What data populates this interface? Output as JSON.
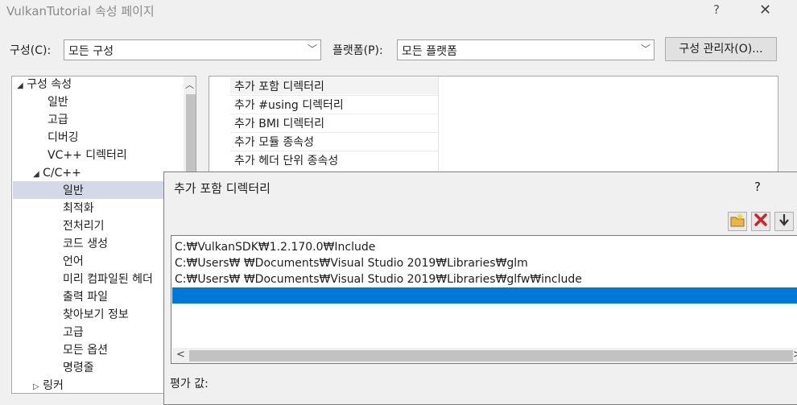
{
  "window": {
    "title": "VulkanTutorial 속성 페이지",
    "help": "?",
    "close": "✕"
  },
  "config": {
    "config_label": "구성(C):",
    "config_value": "모든 구성",
    "platform_label": "플랫폼(P):",
    "platform_value": "모든 플랫폼",
    "manager_button": "구성 관리자(O)..."
  },
  "tree": {
    "root": "구성 속성",
    "items": [
      "일반",
      "고급",
      "디버깅",
      "VC++ 디렉터리"
    ],
    "cc": "C/C++",
    "cc_items": [
      "일반",
      "최적화",
      "전처리기",
      "코드 생성",
      "언어",
      "미리 컴파일된 헤더",
      "출력 파일",
      "찾아보기 정보",
      "고급",
      "모든 옵션",
      "명령줄"
    ],
    "linker": "링커"
  },
  "grid": {
    "rows": [
      "추가 포함 디렉터리",
      "추가 #using 디렉터리",
      "추가 BMI 디렉터리",
      "추가 모듈 종속성",
      "추가 헤더 단위 종속성"
    ]
  },
  "dialog": {
    "title": "추가 포함 디렉터리",
    "help": "?",
    "toolbar": {
      "new_folder": "new-folder-icon",
      "delete": "delete-icon",
      "move_down": "arrow-down-icon"
    },
    "paths": [
      "C:₩VulkanSDK₩1.2.170.0₩Include",
      "C:₩Users₩          ₩Documents₩Visual Studio 2019₩Libraries₩glm",
      "C:₩Users₩          ₩Documents₩Visual Studio 2019₩Libraries₩glfw₩include"
    ],
    "evaluated_label": "평가 값:"
  },
  "colors": {
    "selection": "#0078d7",
    "tree_selection": "#d5d8e6"
  }
}
